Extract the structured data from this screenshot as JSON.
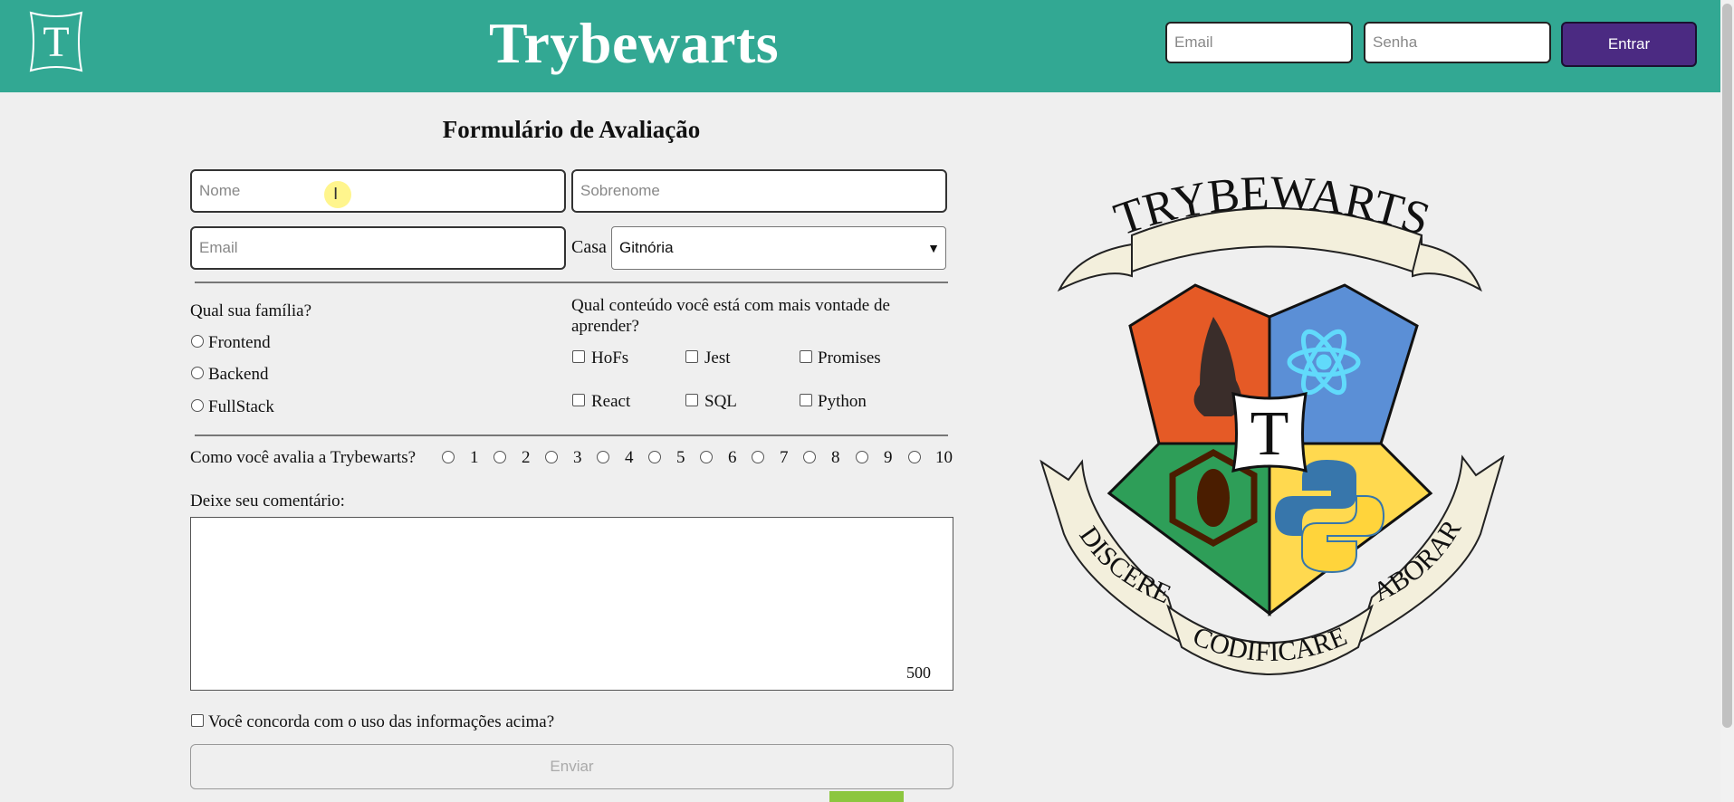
{
  "header": {
    "logo_letter": "T",
    "title": "Trybewarts",
    "email_placeholder": "Email",
    "password_placeholder": "Senha",
    "login_button": "Entrar",
    "bg_color": "#32a893",
    "button_color": "#4b2a82"
  },
  "form": {
    "title": "Formulário de Avaliação",
    "nome_placeholder": "Nome",
    "sobrenome_placeholder": "Sobrenome",
    "email_placeholder": "Email",
    "casa_label": "Casa",
    "casa_selected": "Gitnória",
    "familia_question": "Qual sua família?",
    "familia_options": [
      "Frontend",
      "Backend",
      "FullStack"
    ],
    "conteudo_question": "Qual conteúdo você está com mais vontade de aprender?",
    "conteudo_options": [
      "HoFs",
      "Jest",
      "Promises",
      "React",
      "SQL",
      "Python"
    ],
    "rating_question": "Como você avalia a Trybewarts?",
    "rating_options": [
      "1",
      "2",
      "3",
      "4",
      "5",
      "6",
      "7",
      "8",
      "9",
      "10"
    ],
    "comment_label": "Deixe seu comentário:",
    "char_counter": "500",
    "agreement_label": "Você concorda com o uso das informações acima?",
    "submit_button": "Enviar"
  },
  "crest": {
    "banner_top": "TRYBEWARTS",
    "center_letter": "T",
    "banner_left": "DISCERE",
    "banner_bottom": "CODIFICARE",
    "banner_right": "LABORARE",
    "colors": {
      "red": "#e55a26",
      "blue": "#5b8fd6",
      "green": "#2e9e58",
      "yellow": "#ffd94f",
      "ribbon": "#f3efdc"
    }
  }
}
